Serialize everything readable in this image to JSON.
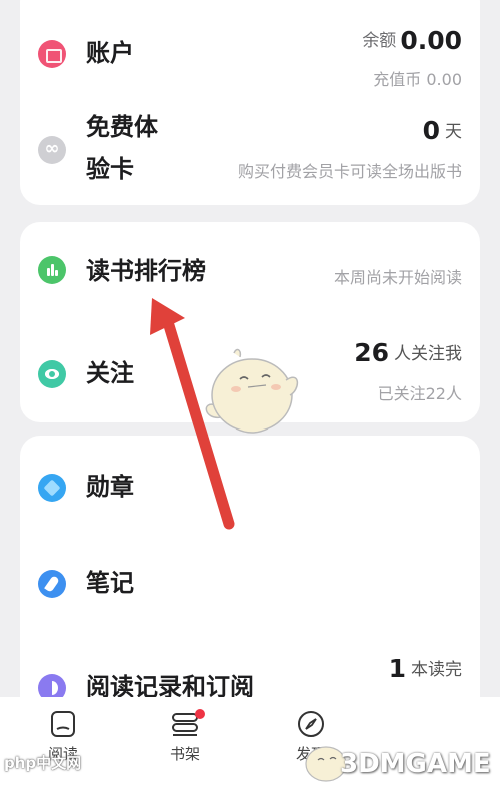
{
  "account": {
    "label": "账户",
    "balance_label": "余额",
    "balance_value": "0.00",
    "coins_text": "充值币 0.00"
  },
  "trial": {
    "label_line1": "免费体",
    "label_line2": "验卡",
    "days_value": "0",
    "days_unit": "天",
    "sub_text": "购买付费会员卡可读全场出版书"
  },
  "ranking": {
    "label": "读书排行榜",
    "right_text": "本周尚未开始阅读"
  },
  "follow": {
    "label": "关注",
    "followers_value": "26",
    "followers_suffix": "人关注我",
    "following_text": "已关注22人"
  },
  "medal": {
    "label": "勋章"
  },
  "notes": {
    "label": "笔记"
  },
  "history": {
    "label": "阅读记录和订阅",
    "finished_value": "1",
    "finished_suffix": "本读完"
  },
  "bottom_nav": {
    "items": [
      {
        "label": "阅读",
        "icon": "book-open-icon"
      },
      {
        "label": "书架",
        "icon": "bookshelf-icon"
      },
      {
        "label": "发现",
        "icon": "compass-icon"
      }
    ]
  },
  "watermarks": {
    "php_text": "php中文网",
    "game_text": "3DMGAME"
  },
  "colors": {
    "account_icon": "#f05375",
    "trial_icon": "#cfcfd3",
    "ranking_icon": "#4cc56a",
    "follow_icon": "#40c9a5",
    "medal_icon": "#36a6f2",
    "notes_icon": "#3d90f0",
    "history_icon": "#8a7af0",
    "arrow": "#e0413a",
    "badge": "#ee3344"
  }
}
